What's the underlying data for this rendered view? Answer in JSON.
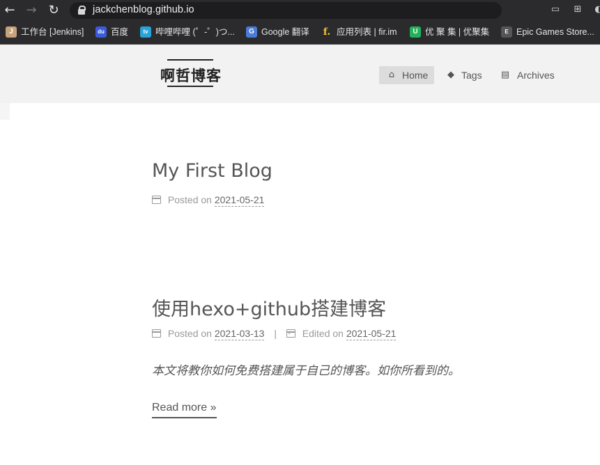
{
  "browser": {
    "back_glyph": "←",
    "forward_glyph": "→",
    "reload_glyph": "↻",
    "url": "jackchenblog.github.io",
    "right_icons": [
      "cast-icon",
      "extensions-icon"
    ]
  },
  "bookmarks": [
    {
      "label": "工作台 [Jenkins]",
      "icon": "jenkins-icon",
      "color": "#c9a27a",
      "glyph": "J"
    },
    {
      "label": "百度",
      "icon": "baidu-icon",
      "color": "#3b5bdb",
      "glyph": "du"
    },
    {
      "label": "哔哩哔哩 (゜-゜)つ...",
      "icon": "bilibili-icon",
      "color": "#2aa3d8",
      "glyph": "tv"
    },
    {
      "label": "Google 翻译",
      "icon": "google-translate-icon",
      "color": "#4a7bd6",
      "glyph": "G"
    },
    {
      "label": "应用列表 | fir.im",
      "icon": "fir-icon",
      "color": "#2b2b2d",
      "glyph": "f."
    },
    {
      "label": "优 聚 集 | 优聚集",
      "icon": "youjuji-icon",
      "color": "#22b35a",
      "glyph": "U"
    },
    {
      "label": "Epic Games Store...",
      "icon": "epic-games-icon",
      "color": "#555555",
      "glyph": "E"
    }
  ],
  "site": {
    "title": "啊哲博客",
    "menu": [
      {
        "label": "Home",
        "icon": "home-icon",
        "glyph": "⌂",
        "active": true
      },
      {
        "label": "Tags",
        "icon": "tags-icon",
        "glyph": "◆",
        "active": false
      },
      {
        "label": "Archives",
        "icon": "archive-icon",
        "glyph": "▤",
        "active": false
      }
    ]
  },
  "posts": [
    {
      "title": "My First Blog",
      "posted_label": "Posted on",
      "posted_date": "2021-05-21"
    },
    {
      "title": "使用hexo+github搭建博客",
      "posted_label": "Posted on",
      "posted_date": "2021-03-13",
      "separator": "|",
      "edited_label": "Edited on",
      "edited_date": "2021-05-21",
      "excerpt": "本文将教你如何免费搭建属于自己的博客。如你所看到的。",
      "read_more": "Read more »"
    }
  ]
}
